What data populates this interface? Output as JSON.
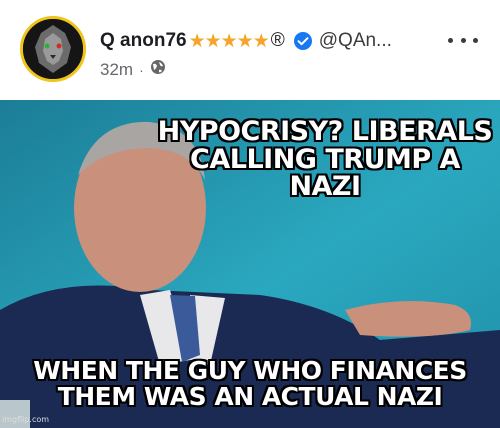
{
  "post": {
    "author_name": "Q anon76",
    "author_stars": "★★★★★",
    "author_registered_mark": "®",
    "handle": "@QAn...",
    "timestamp": "32m",
    "separator": "·",
    "audience_icon": "globe-icon",
    "verified_icon": "verified-badge-icon",
    "more_icon": "more-options-icon"
  },
  "meme": {
    "top_text": "HYPOCRISY? LIBERALS CALLING TRUMP A NAZI",
    "bottom_text": "WHEN THE GUY WHO FINANCES THEM WAS AN ACTUAL NAZI",
    "watermark": "imgflip.com"
  },
  "colors": {
    "avatar_ring": "#f0c419",
    "stars": "#f4a62a",
    "verified": "#1877f2",
    "meme_background": "#1f8fa8"
  }
}
